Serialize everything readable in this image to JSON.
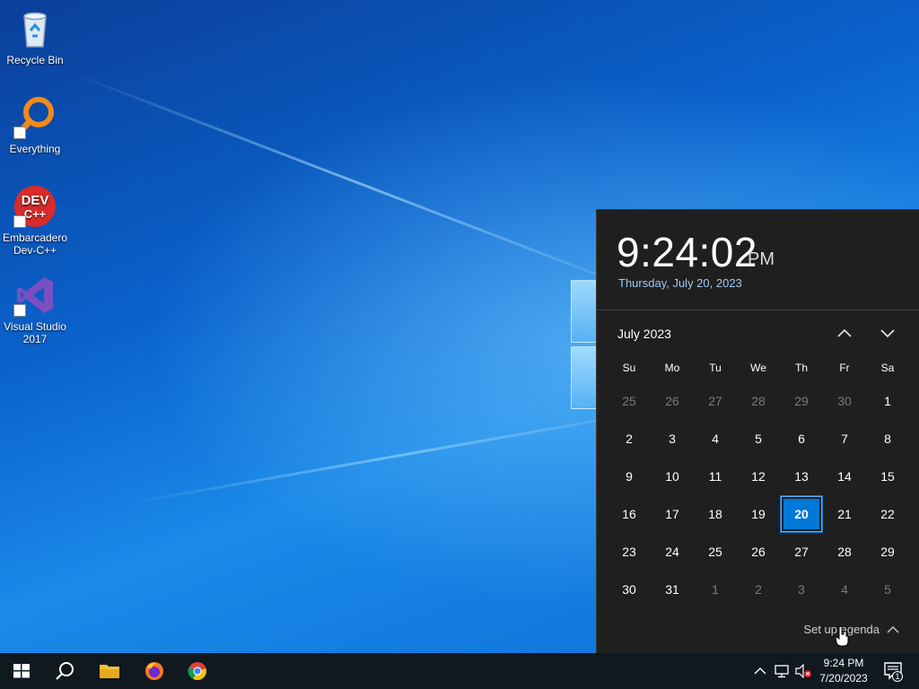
{
  "desktop": {
    "icons": [
      {
        "label": "Recycle Bin",
        "icon": "recycle-bin-icon"
      },
      {
        "label": "Everything",
        "icon": "everything-search-icon"
      },
      {
        "label": "Embarcadero Dev-C++",
        "icon": "devcpp-icon",
        "logo_text": "DEV C++"
      },
      {
        "label": "Visual Studio 2017",
        "icon": "visual-studio-icon"
      }
    ]
  },
  "flyout": {
    "time": "9:24:02",
    "ampm": "PM",
    "date": "Thursday, July 20, 2023",
    "month_label": "July 2023",
    "weekdays": [
      "Su",
      "Mo",
      "Tu",
      "We",
      "Th",
      "Fr",
      "Sa"
    ],
    "weeks": [
      [
        {
          "d": "25",
          "o": true
        },
        {
          "d": "26",
          "o": true
        },
        {
          "d": "27",
          "o": true
        },
        {
          "d": "28",
          "o": true
        },
        {
          "d": "29",
          "o": true
        },
        {
          "d": "30",
          "o": true
        },
        {
          "d": "1"
        }
      ],
      [
        {
          "d": "2"
        },
        {
          "d": "3"
        },
        {
          "d": "4"
        },
        {
          "d": "5"
        },
        {
          "d": "6"
        },
        {
          "d": "7"
        },
        {
          "d": "8"
        }
      ],
      [
        {
          "d": "9"
        },
        {
          "d": "10"
        },
        {
          "d": "11"
        },
        {
          "d": "12"
        },
        {
          "d": "13"
        },
        {
          "d": "14"
        },
        {
          "d": "15"
        }
      ],
      [
        {
          "d": "16"
        },
        {
          "d": "17"
        },
        {
          "d": "18"
        },
        {
          "d": "19"
        },
        {
          "d": "20",
          "today": true
        },
        {
          "d": "21"
        },
        {
          "d": "22"
        }
      ],
      [
        {
          "d": "23"
        },
        {
          "d": "24"
        },
        {
          "d": "25"
        },
        {
          "d": "26"
        },
        {
          "d": "27"
        },
        {
          "d": "28"
        },
        {
          "d": "29"
        }
      ],
      [
        {
          "d": "30"
        },
        {
          "d": "31"
        },
        {
          "d": "1",
          "o": true
        },
        {
          "d": "2",
          "o": true
        },
        {
          "d": "3",
          "o": true
        },
        {
          "d": "4",
          "o": true
        },
        {
          "d": "5",
          "o": true
        }
      ]
    ],
    "agenda_label": "Set up agenda"
  },
  "taskbar": {
    "apps": [
      "start-icon",
      "search-icon",
      "file-explorer-icon",
      "firefox-icon",
      "chrome-icon"
    ],
    "clock_time": "9:24 PM",
    "clock_date": "7/20/2023",
    "notification_count": "1"
  },
  "colors": {
    "accent": "#0078d7",
    "flyout_bg": "#1f1f1f",
    "date_link": "#9ec9f0"
  }
}
